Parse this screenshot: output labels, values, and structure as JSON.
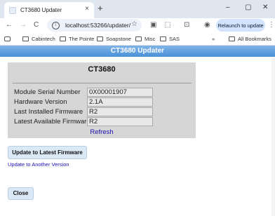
{
  "browser": {
    "tab_title": "CT3680 Updater",
    "tab_close": "×",
    "new_tab": "+",
    "window_controls": {
      "minimize": "–",
      "maximize": "▢",
      "close": "✕"
    },
    "nav": {
      "back": "←",
      "forward": "→",
      "reload": "C"
    },
    "url": "localhost:53266/updater/",
    "bookmark_star": "☆",
    "extension_icons": [
      "▣",
      "⬚",
      "⊡",
      "◉"
    ],
    "relaunch_label": "Relaunch to update",
    "menu": "⋮",
    "bookmarks": [
      "Cabintech",
      "The Pointe",
      "Soapstone",
      "Misc",
      "SAS"
    ],
    "bookmarks_overflow": "»",
    "all_bookmarks": "All Bookmarks"
  },
  "page": {
    "banner": "CT3680 Updater",
    "device_name": "CT3680",
    "fields": [
      {
        "label": "Module Serial Number",
        "value": "0X00001907"
      },
      {
        "label": "Hardware Version",
        "value": "2.1A"
      },
      {
        "label": "Last Installed Firmware",
        "value": "R2"
      },
      {
        "label": "Latest Available Firmware",
        "value": "R2"
      }
    ],
    "refresh": "Refresh",
    "update_latest": "Update to Latest Firmware",
    "update_other": "Update to Another Version",
    "close": "Close"
  }
}
